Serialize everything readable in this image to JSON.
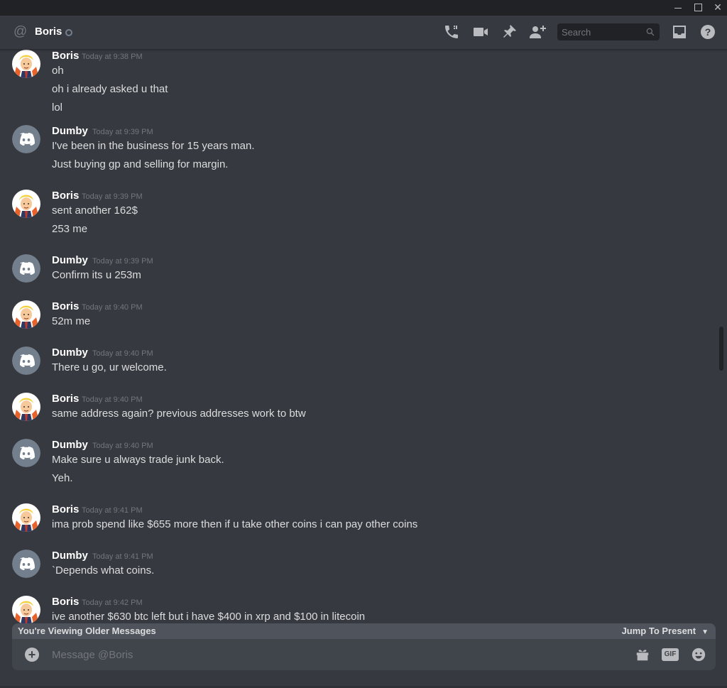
{
  "window": {
    "min_icon": "minimize-icon",
    "max_icon": "maximize-icon",
    "close_icon": "close-icon",
    "close_label": "✕"
  },
  "header": {
    "at_symbol": "@",
    "name": "Boris",
    "icons": [
      "call-icon",
      "video-icon",
      "pin-icon",
      "add-friend-icon",
      "inbox-icon",
      "help-icon"
    ],
    "search_placeholder": "Search"
  },
  "colors": {
    "background": "#36393f",
    "titlebar": "#202225",
    "text": "#dcddde",
    "muted": "#72767d",
    "discord_avatar": "#747f8d"
  },
  "messages": [
    {
      "author": "Boris",
      "timestamp": "Today at 9:38 PM",
      "avatar": "boris",
      "lines": [
        "oh",
        "oh i already asked u that",
        "lol"
      ]
    },
    {
      "author": "Dumby",
      "timestamp": "Today at 9:39 PM",
      "avatar": "discord",
      "lines": [
        "I've been in the business for 15 years man.",
        "Just buying gp and selling for margin."
      ]
    },
    {
      "author": "Boris",
      "timestamp": "Today at 9:39 PM",
      "avatar": "boris",
      "lines": [
        "sent another 162$",
        "253 me"
      ]
    },
    {
      "author": "Dumby",
      "timestamp": "Today at 9:39 PM",
      "avatar": "discord",
      "lines": [
        "Confirm its u 253m"
      ]
    },
    {
      "author": "Boris",
      "timestamp": "Today at 9:40 PM",
      "avatar": "boris",
      "lines": [
        "52m me"
      ]
    },
    {
      "author": "Dumby",
      "timestamp": "Today at 9:40 PM",
      "avatar": "discord",
      "lines": [
        "There u go, ur welcome."
      ]
    },
    {
      "author": "Boris",
      "timestamp": "Today at 9:40 PM",
      "avatar": "boris",
      "lines": [
        "same address again? previous addresses work to btw"
      ]
    },
    {
      "author": "Dumby",
      "timestamp": "Today at 9:40 PM",
      "avatar": "discord",
      "lines": [
        "Make sure u always trade junk back.",
        "Yeh."
      ]
    },
    {
      "author": "Boris",
      "timestamp": "Today at 9:41 PM",
      "avatar": "boris",
      "lines": [
        "ima prob spend like $655 more then if u take other coins i can pay other coins"
      ]
    },
    {
      "author": "Dumby",
      "timestamp": "Today at 9:41 PM",
      "avatar": "discord",
      "lines": [
        "`Depends what coins."
      ]
    },
    {
      "author": "Boris",
      "timestamp": "Today at 9:42 PM",
      "avatar": "boris",
      "lines": [
        "ive another $630 btc left but i have $400 in xrp and $100 in litecoin"
      ]
    }
  ],
  "older_bar": {
    "text": "You're Viewing Older Messages",
    "jump_label": "Jump To Present",
    "jump_icon": "chevron-down-icon"
  },
  "composer": {
    "placeholder": "Message @Boris",
    "plus": "+",
    "gif_label": "GIF",
    "icons": [
      "attach-plus-icon",
      "gift-icon",
      "gif-icon",
      "emoji-icon"
    ]
  }
}
